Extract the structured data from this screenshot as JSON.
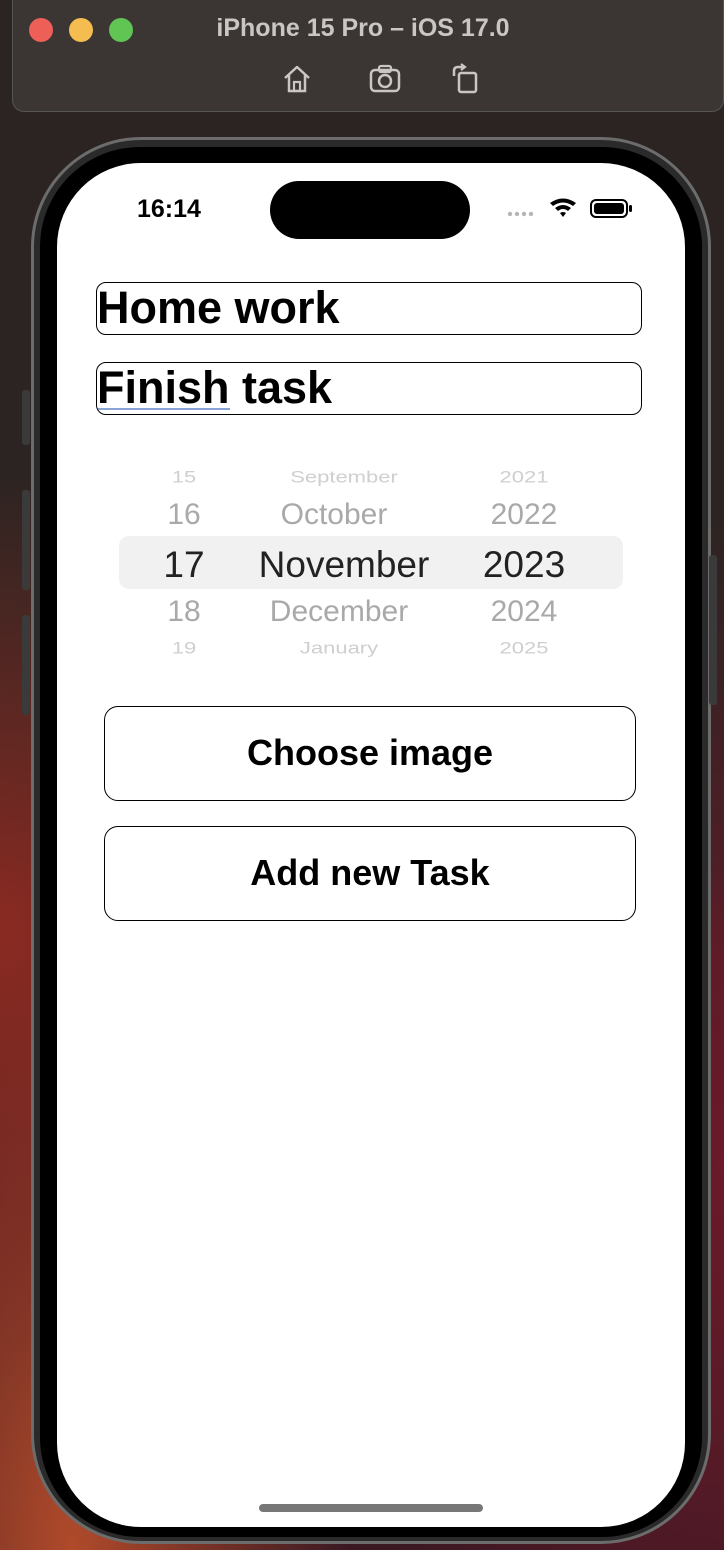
{
  "simulator": {
    "title": "iPhone 15 Pro – iOS 17.0",
    "toolbar": [
      {
        "icon": "home-icon"
      },
      {
        "icon": "screenshot-icon"
      },
      {
        "icon": "rotate-icon"
      }
    ]
  },
  "status_bar": {
    "time": "16:14",
    "icons": [
      "cellular-dots-icon",
      "wifi-icon",
      "battery-icon"
    ]
  },
  "form": {
    "title_field": {
      "value": "Home work"
    },
    "description_field": {
      "value": "Finish task"
    },
    "date_picker": {
      "days": [
        "15",
        "16",
        "17",
        "18",
        "19"
      ],
      "months": [
        "September",
        "October",
        "November",
        "December",
        "January"
      ],
      "years": [
        "2021",
        "2022",
        "2023",
        "2024",
        "2025"
      ],
      "selected": {
        "day": "17",
        "month": "November",
        "year": "2023"
      }
    },
    "choose_image_label": "Choose image",
    "add_task_label": "Add new Task"
  },
  "colors": {
    "button_border": "#000000",
    "picker_highlight": "#f1f1f2",
    "spellcheck_underline": "#8aa4d8"
  }
}
